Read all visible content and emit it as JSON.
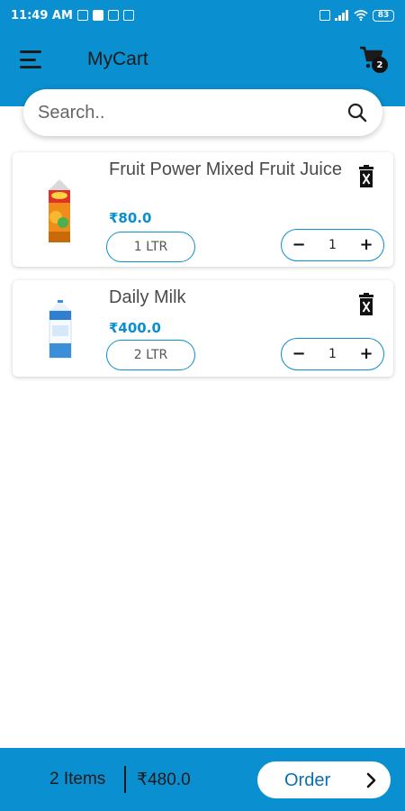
{
  "status_bar": {
    "time": "11:49 AM",
    "battery": "83"
  },
  "app_bar": {
    "title": "MyCart",
    "cart_count": "2"
  },
  "search": {
    "placeholder": "Search.."
  },
  "cart_items": [
    {
      "name": "Fruit Power Mixed Fruit Juice",
      "price": "₹80.0",
      "variant": "1 LTR",
      "quantity": "1",
      "decrement_label": "−",
      "increment_label": "+"
    },
    {
      "name": "Daily Milk",
      "price": "₹400.0",
      "variant": "2 LTR",
      "quantity": "1",
      "decrement_label": "−",
      "increment_label": "+"
    }
  ],
  "footer": {
    "items_count": "2 Items",
    "total": "₹480.0",
    "order_label": "Order"
  },
  "colors": {
    "primary": "#0a8fd0",
    "price": "#0a8fd0",
    "text": "#4a4a4a"
  },
  "icons": [
    "menu-icon",
    "cart-icon",
    "search-icon",
    "delete-icon",
    "chevron-right-icon",
    "wifi-icon",
    "signal-icon",
    "battery-icon"
  ]
}
